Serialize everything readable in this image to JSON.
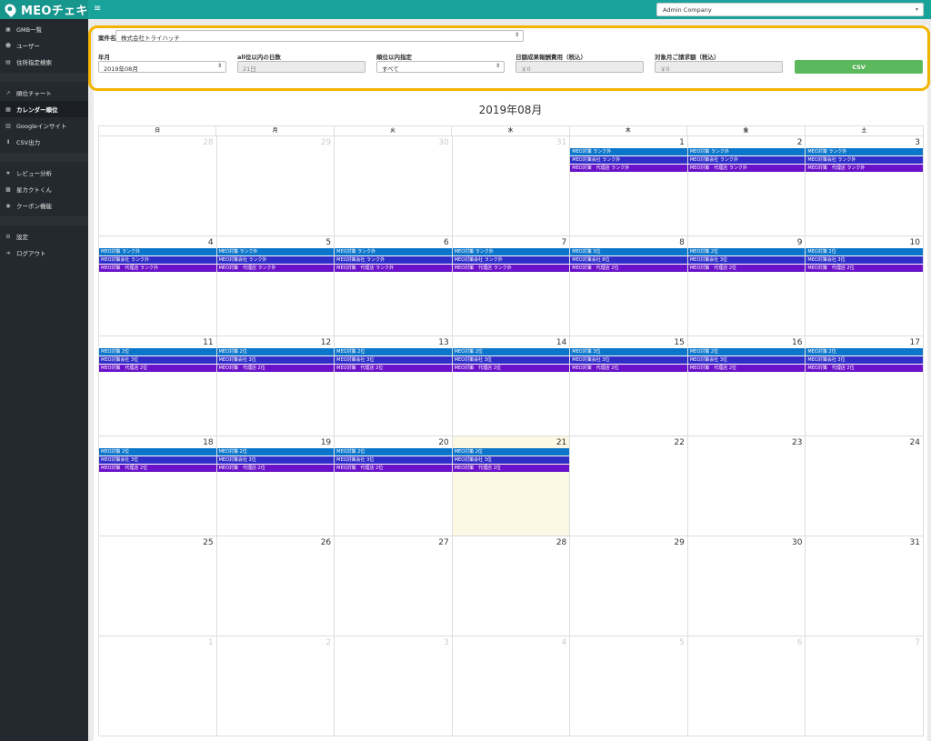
{
  "app": {
    "name": "MEOチェキ"
  },
  "header": {
    "company": "Admin Company"
  },
  "sidebar": {
    "items": [
      {
        "label": "GMB一覧",
        "icon": "building-icon"
      },
      {
        "label": "ユーザー",
        "icon": "users-icon"
      },
      {
        "label": "住所指定検索",
        "icon": "map-icon"
      },
      {
        "label": "順位チャート",
        "icon": "line-chart-icon"
      },
      {
        "label": "カレンダー順位",
        "icon": "calendar-icon",
        "active": true
      },
      {
        "label": "Googleインサイト",
        "icon": "bar-chart-icon"
      },
      {
        "label": "CSV出力",
        "icon": "download-icon"
      },
      {
        "label": "レビュー分析",
        "icon": "star-icon"
      },
      {
        "label": "星カクトくん",
        "icon": "box-icon"
      },
      {
        "label": "クーポン機能",
        "icon": "coupon-icon"
      },
      {
        "label": "設定",
        "icon": "gear-icon"
      },
      {
        "label": "ログアウト",
        "icon": "logout-icon"
      }
    ]
  },
  "filter": {
    "case_label": "案件名",
    "case_value": "株式会社トライハッチ",
    "year_month_label": "年月",
    "year_month_value": "2019年08月",
    "days_label": "all位以内の日数",
    "days_value": "21日",
    "rank_label": "順位以内指定",
    "rank_value": "すべて",
    "daily_cost_label": "日額成果報酬費用（税込）",
    "daily_cost_value": "￥0",
    "monthly_label": "対象月ご請求額（税込）",
    "monthly_value": "￥0",
    "csv_label": "CSV"
  },
  "calendar": {
    "title": "2019年08月",
    "weekdays": [
      "日",
      "月",
      "火",
      "水",
      "木",
      "金",
      "土"
    ],
    "days": [
      {
        "n": "28",
        "other": true,
        "ev": []
      },
      {
        "n": "29",
        "other": true,
        "ev": []
      },
      {
        "n": "30",
        "other": true,
        "ev": []
      },
      {
        "n": "31",
        "other": true,
        "ev": []
      },
      {
        "n": "1",
        "ev": [
          "MEO対策 ランク外",
          "MEO対策会社 ランク外",
          "MEO対策　代理店 ランク外"
        ]
      },
      {
        "n": "2",
        "ev": [
          "MEO対策 ランク外",
          "MEO対策会社 ランク外",
          "MEO対策　代理店 ランク外"
        ]
      },
      {
        "n": "3",
        "ev": [
          "MEO対策 ランク外",
          "MEO対策会社 ランク外",
          "MEO対策　代理店 ランク外"
        ]
      },
      {
        "n": "4",
        "ev": [
          "MEO対策 ランク外",
          "MEO対策会社 ランク外",
          "MEO対策　代理店 ランク外"
        ]
      },
      {
        "n": "5",
        "ev": [
          "MEO対策 ランク外",
          "MEO対策会社 ランク外",
          "MEO対策　代理店 ランク外"
        ]
      },
      {
        "n": "6",
        "ev": [
          "MEO対策 ランク外",
          "MEO対策会社 ランク外",
          "MEO対策　代理店 ランク外"
        ]
      },
      {
        "n": "7",
        "ev": [
          "MEO対策 ランク外",
          "MEO対策会社 ランク外",
          "MEO対策　代理店 ランク外"
        ]
      },
      {
        "n": "8",
        "ev": [
          "MEO対策 3位",
          "MEO対策会社 8位",
          "MEO対策　代理店 2位"
        ]
      },
      {
        "n": "9",
        "ev": [
          "MEO対策 2位",
          "MEO対策会社 3位",
          "MEO対策　代理店 2位"
        ]
      },
      {
        "n": "10",
        "ev": [
          "MEO対策 2位",
          "MEO対策会社 3位",
          "MEO対策　代理店 2位"
        ]
      },
      {
        "n": "11",
        "ev": [
          "MEO対策 2位",
          "MEO対策会社 3位",
          "MEO対策　代理店 2位"
        ]
      },
      {
        "n": "12",
        "ev": [
          "MEO対策 2位",
          "MEO対策会社 3位",
          "MEO対策　代理店 2位"
        ]
      },
      {
        "n": "13",
        "ev": [
          "MEO対策 2位",
          "MEO対策会社 3位",
          "MEO対策　代理店 2位"
        ]
      },
      {
        "n": "14",
        "ev": [
          "MEO対策 2位",
          "MEO対策会社 3位",
          "MEO対策　代理店 2位"
        ]
      },
      {
        "n": "15",
        "ev": [
          "MEO対策 3位",
          "MEO対策会社 3位",
          "MEO対策　代理店 2位"
        ]
      },
      {
        "n": "16",
        "ev": [
          "MEO対策 2位",
          "MEO対策会社 3位",
          "MEO対策　代理店 2位"
        ]
      },
      {
        "n": "17",
        "ev": [
          "MEO対策 2位",
          "MEO対策会社 3位",
          "MEO対策　代理店 2位"
        ]
      },
      {
        "n": "18",
        "ev": [
          "MEO対策 2位",
          "MEO対策会社 3位",
          "MEO対策　代理店 2位"
        ]
      },
      {
        "n": "19",
        "ev": [
          "MEO対策 2位",
          "MEO対策会社 3位",
          "MEO対策　代理店 2位"
        ]
      },
      {
        "n": "20",
        "ev": [
          "MEO対策 2位",
          "MEO対策会社 3位",
          "MEO対策　代理店 2位"
        ]
      },
      {
        "n": "21",
        "today": true,
        "ev": [
          "MEO対策 2位",
          "MEO対策会社 3位",
          "MEO対策　代理店 2位"
        ]
      },
      {
        "n": "22",
        "ev": []
      },
      {
        "n": "23",
        "ev": []
      },
      {
        "n": "24",
        "ev": []
      },
      {
        "n": "25",
        "ev": []
      },
      {
        "n": "26",
        "ev": []
      },
      {
        "n": "27",
        "ev": []
      },
      {
        "n": "28",
        "ev": []
      },
      {
        "n": "29",
        "ev": []
      },
      {
        "n": "30",
        "ev": []
      },
      {
        "n": "31",
        "ev": []
      },
      {
        "n": "1",
        "other": true,
        "ev": []
      },
      {
        "n": "2",
        "other": true,
        "ev": []
      },
      {
        "n": "3",
        "other": true,
        "ev": []
      },
      {
        "n": "4",
        "other": true,
        "ev": []
      },
      {
        "n": "5",
        "other": true,
        "ev": []
      },
      {
        "n": "6",
        "other": true,
        "ev": []
      },
      {
        "n": "7",
        "other": true,
        "ev": []
      }
    ]
  },
  "colors": {
    "header": "#1aa39a",
    "sidebar": "#23292e",
    "highlight": "#f3b400",
    "csv": "#5cb85c",
    "event_1": "#0b75c9",
    "event_2": "#2f2ec7",
    "event_3": "#6912c9"
  }
}
